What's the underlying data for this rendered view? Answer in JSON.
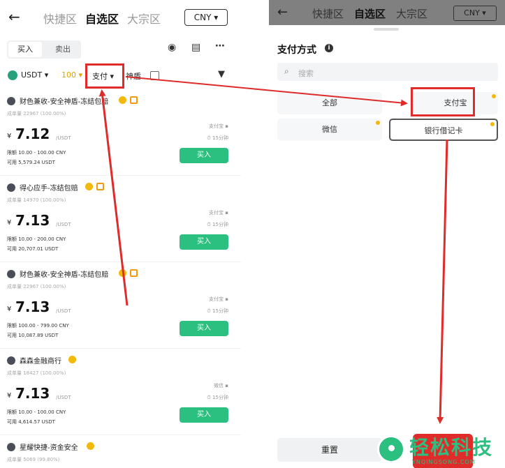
{
  "left": {
    "header": {
      "back_icon": "arrow-left-icon",
      "tabs": [
        "快捷区",
        "自选区",
        "大宗区"
      ],
      "active_tab": "自选区",
      "currency": "CNY ▾"
    },
    "side_tabs": {
      "buy": "买入",
      "sell": "卖出"
    },
    "filters": {
      "asset": "USDT ▾",
      "amount": "100 ▾",
      "payment": "支付 ▾",
      "shield": "神盾"
    },
    "ads": [
      {
        "merchant": "财色兼收-安全神盾-冻结包赔",
        "stats": "成单量 22967 (100.00%)",
        "currency_symbol": "¥",
        "price": "7.12",
        "price_unit": "/USDT",
        "limit": "限额 10.00 - 100.00 CNY",
        "available": "可用 5,579.24 USDT",
        "payment": "支付宝 ▪",
        "time": "⏱ 15分钟",
        "button": "买入"
      },
      {
        "merchant": "得心应手-冻结包赔",
        "stats": "成单量 14970 (100.00%)",
        "currency_symbol": "¥",
        "price": "7.13",
        "price_unit": "/USDT",
        "limit": "限额 10.00 - 200.00 CNY",
        "available": "可用 20,707.01 USDT",
        "payment": "支付宝 ▪",
        "time": "⏱ 15分钟",
        "button": "买入"
      },
      {
        "merchant": "财色兼收-安全神盾-冻结包赔",
        "stats": "成单量 22967 (100.00%)",
        "currency_symbol": "¥",
        "price": "7.13",
        "price_unit": "/USDT",
        "limit": "限额 100.00 - 799.00 CNY",
        "available": "可用 10,087.89 USDT",
        "payment": "支付宝 ▪",
        "time": "⏱ 15分钟",
        "button": "买入"
      },
      {
        "merchant": "森森金融商行",
        "stats": "成单量 18427 (100.00%)",
        "currency_symbol": "¥",
        "price": "7.13",
        "price_unit": "/USDT",
        "limit": "限额 10.00 - 100.00 CNY",
        "available": "可用 4,614.57 USDT",
        "payment": "微信 ▪",
        "time": "⏱ 15分钟",
        "button": "买入"
      }
    ],
    "last_merchant": "星耀快捷-资金安全",
    "last_stats": "成单量 5069 (99.80%)"
  },
  "right": {
    "header": {
      "tabs": [
        "快捷区",
        "自选区",
        "大宗区"
      ],
      "currency": "CNY ▾"
    },
    "sheet": {
      "title": "支付方式",
      "search_placeholder": "搜索",
      "options": [
        "全部",
        "支付宝",
        "微信",
        "银行借记卡"
      ],
      "reset": "重置"
    }
  },
  "watermark": {
    "text": "轻松科技",
    "sub": "YNQINGSONG.COM"
  },
  "colors": {
    "buy_green": "#2bbf80",
    "highlight_red": "#e02b2b",
    "badge_gold": "#f2b90c"
  }
}
